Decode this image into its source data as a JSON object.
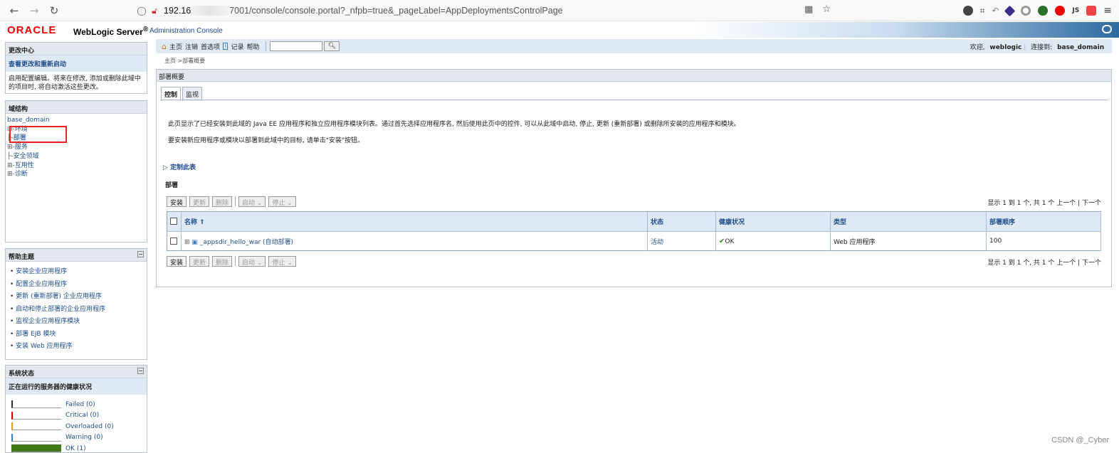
{
  "browser": {
    "url_prefix": "192.16",
    "url_rest": "7001/console/console.portal?_nfpb=true&_pageLabel=AppDeploymentsControlPage"
  },
  "header": {
    "oracle_logo": "ORACLE",
    "product": "WebLogic Server",
    "product_reg": "®",
    "console": "Administration Console"
  },
  "change_center": {
    "title": "更改中心",
    "link": "查看更改和重新启动",
    "text": "启用配置编辑。将来在修改, 添加或删除此域中的项目时, 将自动激活这些更改。"
  },
  "domain_structure": {
    "title": "域结构",
    "root": "base_domain",
    "items": [
      {
        "prefix": "⊞-",
        "label": "环境"
      },
      {
        "prefix": "├-",
        "label": "部署"
      },
      {
        "prefix": "⊞-",
        "label": "服务"
      },
      {
        "prefix": "├-",
        "label": "安全领域"
      },
      {
        "prefix": "⊞-",
        "label": "互用性"
      },
      {
        "prefix": "⊞-",
        "label": "诊断"
      }
    ]
  },
  "help": {
    "title": "帮助主题",
    "items": [
      "安装企业应用程序",
      "配置企业应用程序",
      "更新 (重新部署) 企业应用程序",
      "启动和停止部署的企业应用程序",
      "监视企业应用程序模块",
      "部署 EJB 模块",
      "安装 Web 应用程序"
    ]
  },
  "system_status": {
    "title": "系统状态",
    "subtitle": "正在运行的服务器的健康状况",
    "rows": [
      {
        "label": "Failed (0)",
        "color": "#333333",
        "fraction": 0
      },
      {
        "label": "Critical (0)",
        "color": "#d40000",
        "fraction": 0
      },
      {
        "label": "Overloaded (0)",
        "color": "#d9a020",
        "fraction": 0
      },
      {
        "label": "Warning (0)",
        "color": "#3b7bbf",
        "fraction": 0
      },
      {
        "label": "OK (1)",
        "color": "#3f7a1a",
        "fraction": 1
      }
    ]
  },
  "toolbar": {
    "home": "主页",
    "logout": "注销",
    "prefs": "首选项",
    "record": "记录",
    "help": "帮助",
    "welcome_label": "欢迎,",
    "welcome_user": "weblogic",
    "connected_label": "连接到:",
    "connected_domain": "base_domain"
  },
  "breadcrumb": "主页 >部署概要",
  "content": {
    "title": "部署概要",
    "tabs": [
      "控制",
      "监视"
    ],
    "desc1": "此页显示了已经安装到此域的 Java EE 应用程序和独立应用程序模块列表。通过首先选择应用程序名, 然后使用此页中的控件, 可以从此域中启动, 停止, 更新 (重新部署) 或删除所安装的应用程序和模块。",
    "desc2": "要安装新应用程序或模块以部署到此域中的目标, 请单击\"安装\"按钮。",
    "customize": "定制此表",
    "table_title": "部署",
    "buttons": {
      "install": "安装",
      "update": "更新",
      "delete": "删除",
      "start": "启动 ⌄",
      "stop": "停止 ⌄"
    },
    "pager": "显示 1 到 1 个, 共 1 个  上一个 | 下一个",
    "columns": [
      "名称 ⇑",
      "状态",
      "健康状况",
      "类型",
      "部署顺序"
    ],
    "rows": [
      {
        "name": "_appsdir_hello_war (自动部署)",
        "state": "活动",
        "health": "OK",
        "type": "Web 应用程序",
        "order": "100"
      }
    ]
  },
  "watermark": "CSDN @_Cyber"
}
